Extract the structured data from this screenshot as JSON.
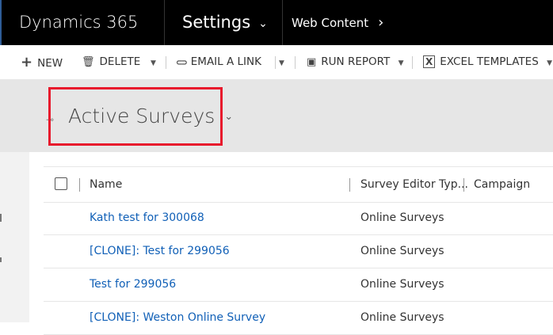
{
  "topbar": {
    "brand": "Dynamics 365",
    "area": "Settings",
    "area_chevron": "⌄",
    "subarea": "Web Content",
    "subarea_chevron": "›"
  },
  "commands": [
    {
      "label": "NEW",
      "icon": "+"
    },
    {
      "label": "DELETE",
      "icon": "🗑"
    },
    {
      "label": "EMAIL A LINK",
      "icon": "⊂⊃"
    },
    {
      "label": "RUN REPORT",
      "icon": "▣"
    },
    {
      "label": "EXCEL TEMPLATES",
      "icon": "X"
    }
  ],
  "view": {
    "pin_icon": "⊸",
    "title": "Active Surveys",
    "chevron": "⌄"
  },
  "grid": {
    "columns": [
      "Name",
      "Survey Editor Typ...",
      "Campaign"
    ],
    "rows": [
      {
        "name": "Kath test for 300068",
        "type": "Online Surveys"
      },
      {
        "name": "[CLONE]: Test for 299056",
        "type": "Online Surveys"
      },
      {
        "name": "Test for 299056",
        "type": "Online Surveys"
      },
      {
        "name": "[CLONE]: Weston Online Survey",
        "type": "Online Surveys"
      }
    ]
  },
  "colors": {
    "topbar": "#000000",
    "link": "#1160b7",
    "highlight": "#e8192c",
    "background": "#e6e6e6"
  }
}
